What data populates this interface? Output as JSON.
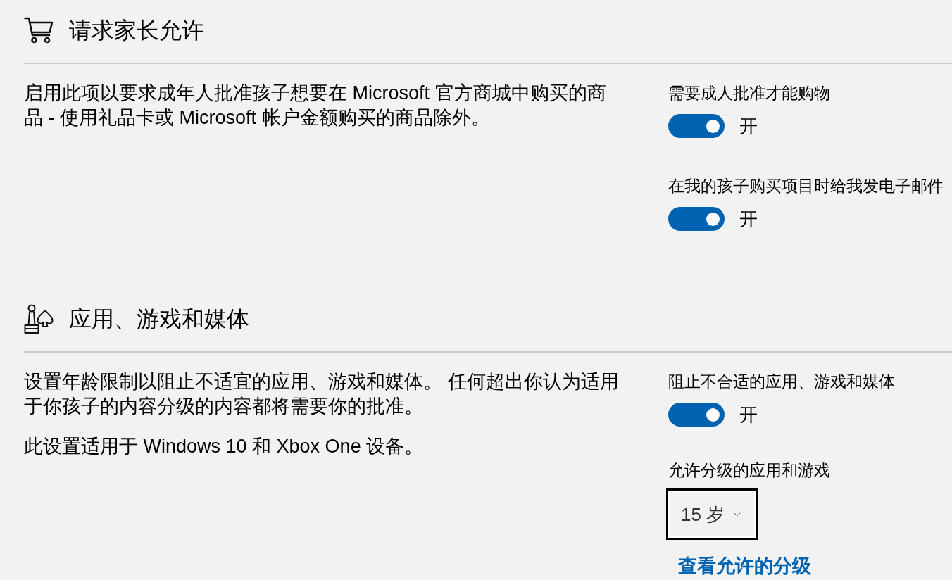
{
  "sections": [
    {
      "kind": "purchase",
      "title": "请求家长允许",
      "description": [
        "启用此项以要求成年人批准孩子想要在 Microsoft 官方商城中购买的商品 - 使用礼品卡或 Microsoft 帐户金额购买的商品除外。"
      ],
      "settings": [
        {
          "kind": "toggle",
          "label": "需要成人批准才能购物",
          "on": true,
          "state_text": "开"
        },
        {
          "kind": "toggle",
          "label": "在我的孩子购买项目时给我发电子邮件",
          "on": true,
          "state_text": "开"
        }
      ]
    },
    {
      "kind": "apps",
      "title": "应用、游戏和媒体",
      "description": [
        "设置年龄限制以阻止不适宜的应用、游戏和媒体。 任何超出你认为适用于你孩子的内容分级的内容都将需要你的批准。",
        "此设置适用于 Windows 10 和 Xbox One 设备。"
      ],
      "settings": [
        {
          "kind": "toggle",
          "label": "阻止不合适的应用、游戏和媒体",
          "on": true,
          "state_text": "开"
        },
        {
          "kind": "dropdown",
          "label": "允许分级的应用和游戏",
          "value": "15 岁",
          "focused": true
        },
        {
          "kind": "link",
          "label": "查看允许的分级"
        }
      ]
    }
  ]
}
